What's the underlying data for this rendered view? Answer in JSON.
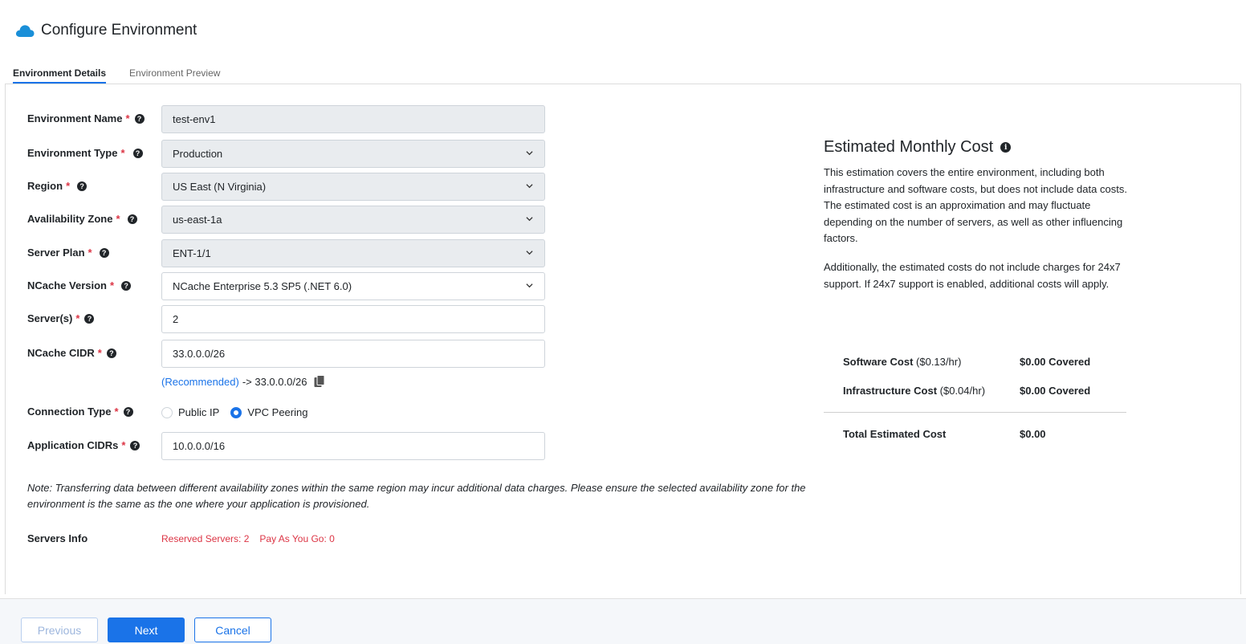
{
  "header": {
    "title": "Configure Environment",
    "icon": "cloud-icon",
    "icon_color": "#1a8fd8"
  },
  "tabs": [
    {
      "label": "Environment Details",
      "active": true
    },
    {
      "label": "Environment Preview",
      "active": false
    }
  ],
  "form": {
    "env_name": {
      "label": "Environment Name",
      "value": "test-env1"
    },
    "env_type": {
      "label": "Environment Type",
      "value": "Production"
    },
    "region": {
      "label": "Region",
      "value": "US East (N Virginia)"
    },
    "az": {
      "label": "Avalilability Zone",
      "value": "us-east-1a"
    },
    "server_plan": {
      "label": "Server Plan",
      "value": "ENT-1/1"
    },
    "ncache_version": {
      "label": "NCache Version",
      "value": "NCache Enterprise 5.3 SP5 (.NET 6.0)"
    },
    "servers": {
      "label": "Server(s)",
      "value": "2"
    },
    "ncache_cidr": {
      "label": "NCache CIDR",
      "value": "33.0.0.0/26"
    },
    "recommended": {
      "link": "(Recommended)",
      "text": "-> 33.0.0.0/26"
    },
    "connection_type": {
      "label": "Connection Type",
      "options": [
        "Public IP",
        "VPC Peering"
      ],
      "selected": "VPC Peering"
    },
    "app_cidrs": {
      "label": "Application CIDRs",
      "value": "10.0.0.0/16"
    },
    "required_mark": "*",
    "help_glyph": "?"
  },
  "note": "Note: Transferring data between different availability zones within the same region may incur additional data charges. Please ensure the selected availability zone for the environment is the same as the one where your application is provisioned.",
  "servers_info": {
    "label": "Servers Info",
    "reserved": "Reserved Servers: 2",
    "payg": "Pay As You Go: 0"
  },
  "cost": {
    "title": "Estimated Monthly Cost",
    "info_glyph": "i",
    "desc1": "This estimation covers the entire environment, including both infrastructure and software costs, but does not include data costs. The estimated cost is an approximation and may fluctuate depending on the number of servers, as well as other influencing factors.",
    "desc2": "Additionally, the estimated costs do not include charges for 24x7 support. If 24x7 support is enabled, additional costs will apply.",
    "software": {
      "label": "Software Cost",
      "rate": "($0.13/hr)",
      "value": "$0.00 Covered"
    },
    "infra": {
      "label": "Infrastructure Cost",
      "rate": "($0.04/hr)",
      "value": "$0.00 Covered"
    },
    "total": {
      "label": "Total Estimated Cost",
      "value": "$0.00"
    }
  },
  "footer": {
    "previous": "Previous",
    "next": "Next",
    "cancel": "Cancel"
  },
  "colors": {
    "accent": "#1a73e8",
    "required": "#dc3545"
  }
}
